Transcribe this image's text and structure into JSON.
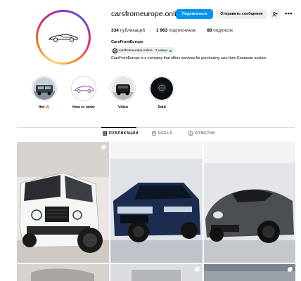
{
  "profile": {
    "username": "carsfromeurope.online",
    "follow_label": "Подписаться",
    "message_label": "Отправить сообщение",
    "add_user_label": "+ᴿ",
    "more_label": "•••",
    "stats": {
      "posts_count": "334",
      "posts_label": "публикаций",
      "followers_count": "1 963",
      "followers_label": "подписчиков",
      "following_count": "88",
      "following_label": "подписок"
    },
    "full_name": "CarsFromEurope",
    "threads_badge": "carsfromeurope.online · 2 новых",
    "bio": "CarsFromEurope is a company that offers services for purchasing cars from European auction"
  },
  "highlights": [
    {
      "label": "Hot 🔥",
      "icon": "car-photo-icon"
    },
    {
      "label": "How to order",
      "icon": "car-logo-icon"
    },
    {
      "label": "Video",
      "icon": "car-photo-icon"
    },
    {
      "label": "Sold",
      "icon": "car-photo-icon"
    }
  ],
  "tabs": [
    {
      "label": "ПУБЛИКАЦИИ",
      "icon": "grid-icon",
      "active": true
    },
    {
      "label": "REELS",
      "icon": "reels-icon",
      "active": false
    },
    {
      "label": "ОТМЕТКИ",
      "icon": "tag-icon",
      "active": false
    }
  ],
  "posts": [
    {
      "subject": "white g-class",
      "multi": true
    },
    {
      "subject": "blue range rover",
      "multi": false
    },
    {
      "subject": "grey porsche 911",
      "multi": false
    },
    {
      "subject": "car",
      "multi": false
    },
    {
      "subject": "car",
      "multi": true
    },
    {
      "subject": "car",
      "multi": true
    }
  ],
  "colors": {
    "accent": "#0095f6",
    "button_grey": "#efefef",
    "divider": "#dbdbdb"
  }
}
